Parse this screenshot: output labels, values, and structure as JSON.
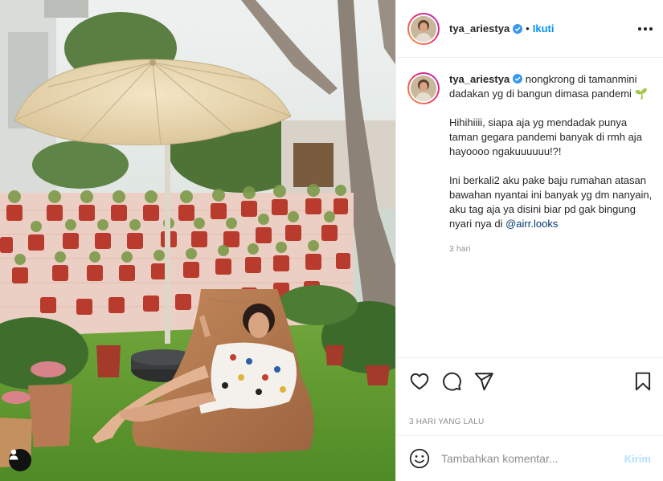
{
  "header": {
    "username": "tya_ariestya",
    "separator": "•",
    "follow_label": "Ikuti"
  },
  "caption": {
    "username": "tya_ariestya",
    "line1": "nongkrong di tamanmini dadakan yg di bangun dimasa pandemi 🌱",
    "line2": "Hihihiiii, siapa aja yg mendadak punya taman gegara pandemi banyak di rmh aja hayoooo ngakuuuuuu!?!",
    "line3": "Ini berkali2 aku pake baju rumahan atasan bawahan nyantai ini banyak yg dm nanyain, aku tag aja ya disini biar pd gak bingung nyari nya di",
    "mention": "@airr.looks",
    "time_ago": "3 hari"
  },
  "actions": {
    "like_icon": "heart-icon",
    "comment_icon": "comment-icon",
    "share_icon": "share-icon",
    "save_icon": "bookmark-icon"
  },
  "post_date": "3 HARI YANG LALU",
  "comment": {
    "placeholder": "Tambahkan komentar...",
    "post_label": "Kirim"
  },
  "colors": {
    "accent": "#0095f6",
    "mention": "#00376b",
    "muted": "#8e8e8e",
    "post_disabled": "#b2dffc"
  }
}
